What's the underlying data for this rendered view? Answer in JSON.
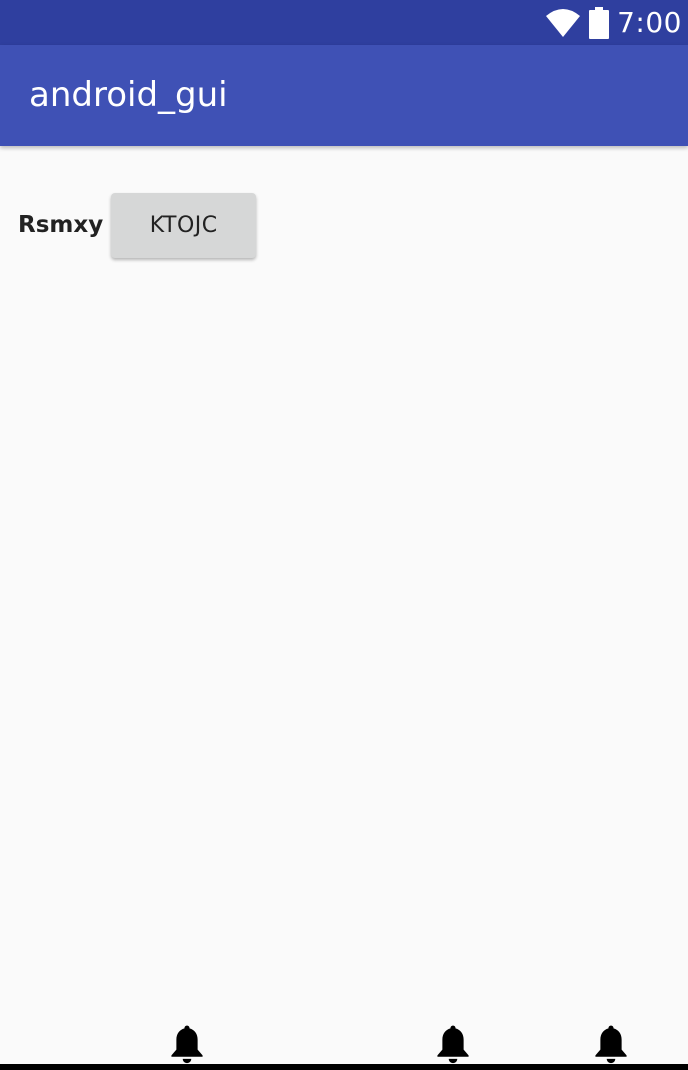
{
  "status_bar": {
    "time": "7:00",
    "icons": [
      "wifi-icon",
      "battery-icon"
    ],
    "color": "#2f3f9f"
  },
  "app_bar": {
    "title": "android_gui",
    "color": "#3f51b5"
  },
  "content": {
    "label": "Rsmxy",
    "button_label": "KTOJC"
  },
  "bottom": {
    "icons": [
      "bell-icon",
      "bell-icon",
      "bell-icon"
    ]
  }
}
